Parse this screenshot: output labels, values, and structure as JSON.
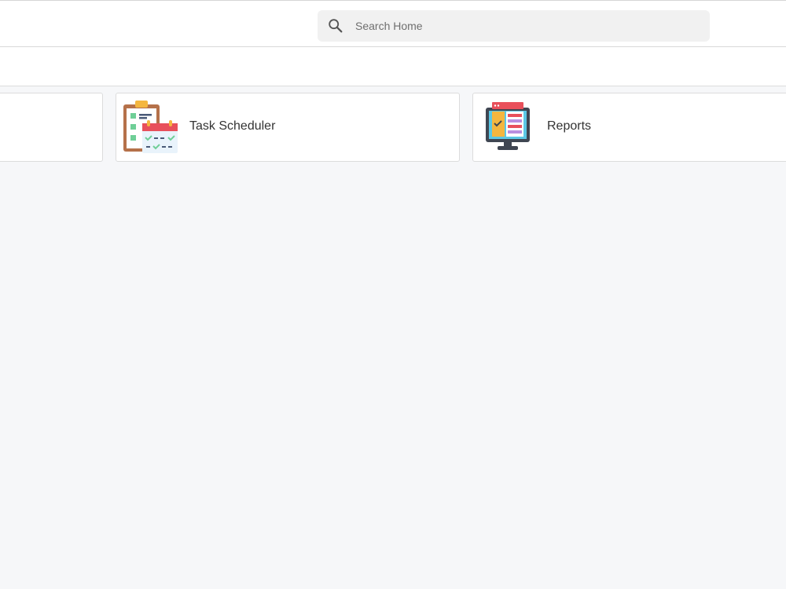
{
  "search": {
    "placeholder": "Search Home",
    "icon": "search-icon"
  },
  "cards": [
    {
      "label": "",
      "icon": ""
    },
    {
      "label": "Task Scheduler",
      "icon": "task-scheduler-icon"
    },
    {
      "label": "Reports",
      "icon": "reports-monitor-icon"
    }
  ],
  "colors": {
    "background": "#f6f7f9",
    "card": "#ffffff",
    "search_bg": "#f1f1f1",
    "border": "#dcdcdc"
  }
}
